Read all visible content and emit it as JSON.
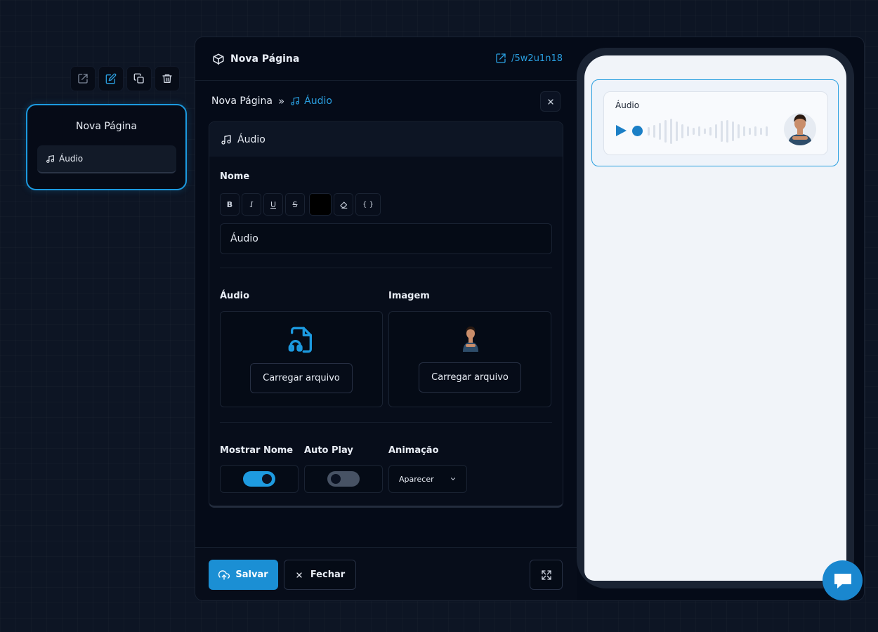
{
  "node": {
    "title": "Nova Página",
    "item_label": "Áudio",
    "toolbar": {
      "open": "external-link-icon",
      "edit": "edit-icon",
      "copy": "copy-icon",
      "delete": "trash-icon"
    }
  },
  "panel": {
    "title": "Nova Página",
    "slug": "/5w2u1n18",
    "breadcrumb": {
      "root": "Nova Página",
      "current": "Áudio"
    },
    "card_title": "Áudio",
    "name_label": "Nome",
    "name_value": "Áudio",
    "format": {
      "bold": "B",
      "italic": "I",
      "underline": "U",
      "strike": "S",
      "braces": "{ }"
    },
    "audio_label": "Áudio",
    "image_label": "Imagem",
    "upload_audio": "Carregar arquivo",
    "upload_image": "Carregar arquivo",
    "show_name_label": "Mostrar Nome",
    "show_name_on": true,
    "autoplay_label": "Auto Play",
    "autoplay_on": false,
    "animation_label": "Animação",
    "animation_value": "Aparecer",
    "save": "Salvar",
    "close": "Fechar"
  },
  "preview": {
    "audio_name": "Áudio"
  },
  "colors": {
    "accent": "#1c9ae0",
    "background": "#0d1524",
    "panel": "#050b18"
  }
}
